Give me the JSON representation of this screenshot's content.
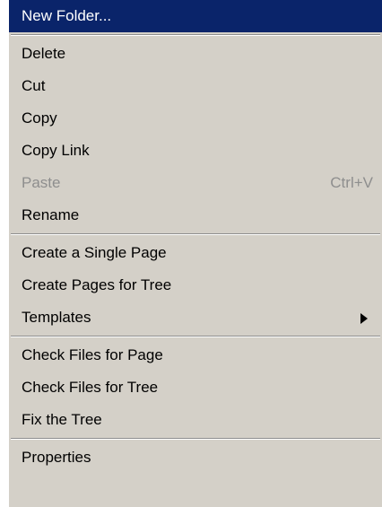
{
  "menu": {
    "new_folder": "New Folder...",
    "delete": "Delete",
    "cut": "Cut",
    "copy": "Copy",
    "copy_link": "Copy Link",
    "paste": "Paste",
    "paste_shortcut": "Ctrl+V",
    "rename": "Rename",
    "create_single_page": "Create a Single Page",
    "create_pages_for_tree": "Create Pages for Tree",
    "templates": "Templates",
    "check_files_for_page": "Check Files for Page",
    "check_files_for_tree": "Check Files for Tree",
    "fix_the_tree": "Fix the Tree",
    "properties": "Properties"
  },
  "colors": {
    "menu_background": "#d4d0c8",
    "highlight_background": "#0a246a",
    "highlight_text": "#ffffff",
    "disabled_text": "#8e8e8e"
  },
  "icons": {
    "templates_submenu": "submenu-arrow-icon"
  }
}
